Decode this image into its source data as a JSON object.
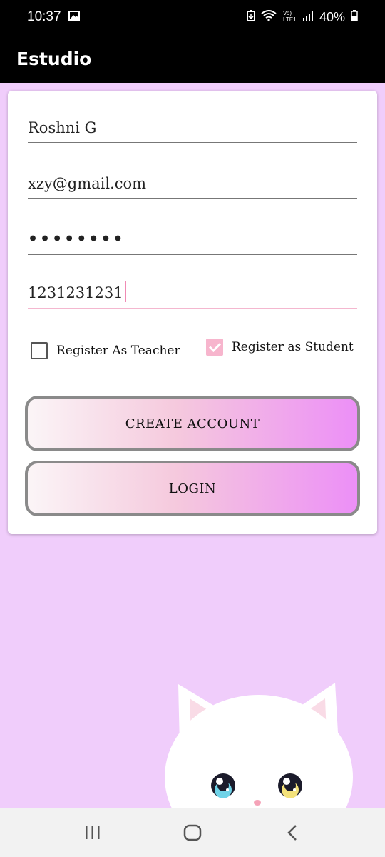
{
  "status_bar": {
    "time": "10:37",
    "battery": "40%",
    "icons": [
      "gallery-icon",
      "battery-saver-icon",
      "wifi-icon",
      "volte-icon",
      "signal-icon",
      "battery-icon"
    ]
  },
  "app_bar": {
    "title": "Estudio"
  },
  "form": {
    "name_value": "Roshni G",
    "email_value": "xzy@gmail.com",
    "password_value": "••••••••",
    "phone_value": "1231231231"
  },
  "checkboxes": {
    "teacher_label": "Register As Teacher",
    "teacher_checked": false,
    "student_label": "Register as Student",
    "student_checked": true
  },
  "buttons": {
    "create_account_label": "CREATE ACCOUNT",
    "login_label": "LOGIN"
  },
  "colors": {
    "background": "#f0cdfb",
    "accent_pink": "#f7b5cd",
    "gradient_end": "#ec8ff7"
  },
  "nav_bar": {
    "icons": [
      "recent-apps-icon",
      "home-icon",
      "back-icon"
    ]
  }
}
